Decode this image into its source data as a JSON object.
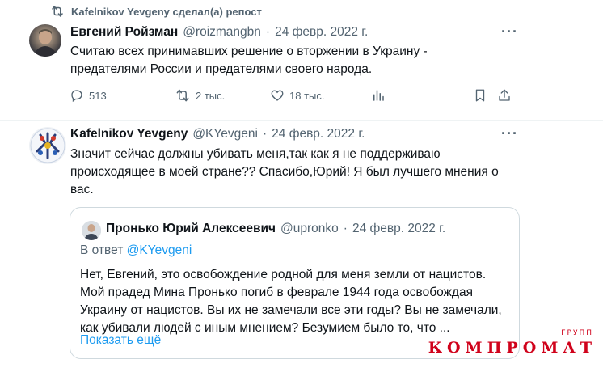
{
  "repost": {
    "text": "Kafelnikov Yevgeny сделал(а) репост"
  },
  "tweet1": {
    "author": "Евгений Ройзман",
    "handle": "@roizmangbn",
    "sep": "·",
    "date": "24 февр. 2022 г.",
    "text_line1": "Считаю всех принимавших решение о вторжении в Украину -",
    "text_line2": "предателями России и предателями  своего народа.",
    "replies": "513",
    "reposts": "2 тыс.",
    "likes": "18 тыс."
  },
  "tweet2": {
    "author": "Kafelnikov Yevgeny",
    "handle": "@KYevgeni",
    "sep": "·",
    "date": "24 февр. 2022 г.",
    "text_line1": "Значит сейчас должны убивать меня,так как я не поддерживаю",
    "text_line2": "происходящее в моей стране?? Спасибо,Юрий! Я был лучшего мнения о",
    "text_line3": "вас."
  },
  "quote": {
    "author": "Пронько Юрий Алексеевич",
    "handle": "@upronko",
    "sep": "·",
    "date": "24 февр. 2022 г.",
    "reply_to_prefix": "В ответ ",
    "reply_to_handle": "@KYevgeni",
    "text_line1": "Нет, Евгений, это освобождение родной для меня земли от нацистов.",
    "text_line2": "Мой прадед Мина Пронько погиб в феврале 1944 года освобождая",
    "text_line3": "Украину от нацистов. Вы их не замечали все эти годы? Вы не замечали,",
    "text_line4": "как убивали людей с иным мнением? Безумием было то, что ...",
    "show_more": "Показать ещё"
  },
  "watermark": {
    "small": "ГРУПП",
    "main": "КОМПРОМАТ"
  },
  "colors": {
    "text": "#0f1419",
    "secondary": "#536471",
    "link": "#1d9bf0",
    "watermark": "#d0021b"
  }
}
